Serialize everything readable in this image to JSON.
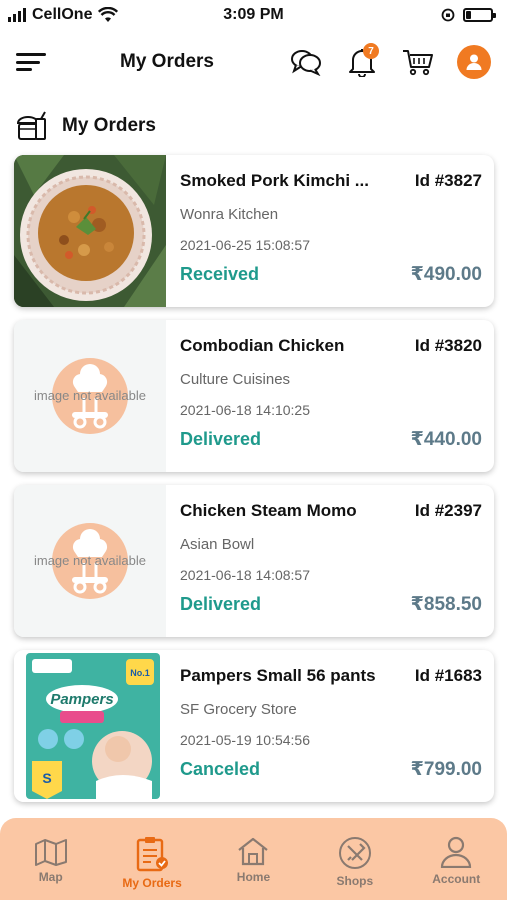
{
  "status_bar": {
    "carrier": "CellOne",
    "time": "3:09 PM"
  },
  "header": {
    "title": "My Orders",
    "cart_badge_count": "7",
    "icons": [
      "menu-icon",
      "chat-icon",
      "bell-icon",
      "cart-icon",
      "user-icon"
    ]
  },
  "section": {
    "title": "My Orders",
    "icon": "food-icon"
  },
  "orders": [
    {
      "name": "Smoked Pork Kimchi ...",
      "id": "Id #3827",
      "shop": "Wonra Kitchen",
      "date": "2021-06-25 15:08:57",
      "status": "Received",
      "price": "₹490.00",
      "image": "food-photo"
    },
    {
      "name": "Combodian Chicken",
      "id": "Id #3820",
      "shop": "Culture Cuisines",
      "date": "2021-06-18 14:10:25",
      "status": "Delivered",
      "price": "₹440.00",
      "image_text": "image not available"
    },
    {
      "name": "Chicken Steam Momo",
      "id": "Id #2397",
      "shop": "Asian Bowl",
      "date": "2021-06-18 14:08:57",
      "status": "Delivered",
      "price": "₹858.50",
      "image_text": "image not available"
    },
    {
      "name": "Pampers Small 56 pants",
      "id": "Id #1683",
      "shop": "SF Grocery Store",
      "date": "2021-05-19 10:54:56",
      "status": "Canceled",
      "price": "₹799.00",
      "image": "pampers-photo",
      "image_text": "Pampers"
    }
  ],
  "bottom_nav": [
    {
      "label": "Map",
      "icon": "map-icon"
    },
    {
      "label": "My Orders",
      "icon": "orders-icon",
      "active": true
    },
    {
      "label": "Home",
      "icon": "home-icon"
    },
    {
      "label": "Shops",
      "icon": "shops-icon"
    },
    {
      "label": "Account",
      "icon": "account-icon"
    }
  ],
  "colors": {
    "accent": "#f07a22",
    "status": "#1f9a8c",
    "price": "#5d7a89",
    "nav_bg": "#fbc7a4"
  }
}
